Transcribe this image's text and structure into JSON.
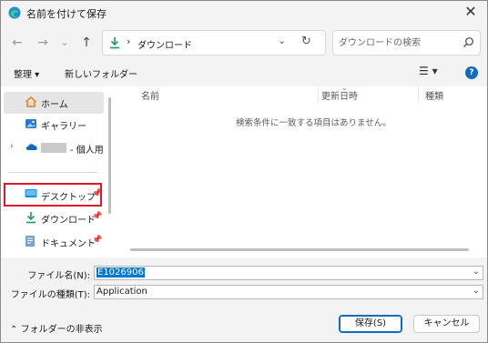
{
  "window": {
    "title": "名前を付けて保存",
    "close_label": "✕"
  },
  "nav": {
    "back": "←",
    "forward": "→",
    "recent": "⌄",
    "up": "↑",
    "address": {
      "separator": "›",
      "path": "ダウンロード"
    },
    "search_placeholder": "ダウンロードの検索"
  },
  "toolbar": {
    "organize_label": "整理 ▾",
    "new_folder_label": "新しいフォルダー",
    "view_label": "☰ ▾",
    "help_label": "?"
  },
  "sidebar": {
    "items": [
      {
        "label": "ホーム",
        "icon": "home-icon"
      },
      {
        "label": "ギャラリー",
        "icon": "gallery-icon"
      },
      {
        "label": "- 個人用",
        "icon": "onedrive-icon"
      },
      {
        "label": "デスクトップ",
        "icon": "desktop-icon",
        "pinned": true
      },
      {
        "label": "ダウンロード",
        "icon": "download-icon",
        "pinned": true
      },
      {
        "label": "ドキュメント",
        "icon": "document-icon",
        "pinned": true
      }
    ],
    "highlight_color": "#e0162b"
  },
  "files": {
    "columns": [
      "名前",
      "更新日時",
      "種類"
    ],
    "empty_message": "検索条件に一致する項目はありません。"
  },
  "form": {
    "filename_label": "ファイル名(N):",
    "filename_value": "E1026906",
    "filetype_label": "ファイルの種類(T):",
    "filetype_value": "Application"
  },
  "footer": {
    "hide_folders_label": "フォルダーの非表示",
    "save_label": "保存(S)",
    "cancel_label": "キャンセル"
  },
  "colors": {
    "accent": "#0f6cbd",
    "selection": "#0078d7"
  }
}
